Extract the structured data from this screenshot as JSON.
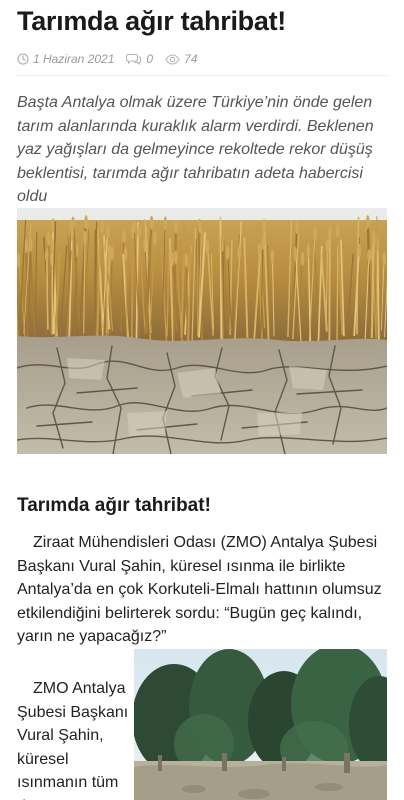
{
  "article": {
    "title": "Tarımda ağır tahribat!",
    "meta": {
      "date": "1 Haziran 2021",
      "comments": "0",
      "views": "74"
    },
    "lead": "Başta Antalya olmak üzere Türkiye’nin önde gelen tarım alanlarında kuraklık alarm verdirdi. Beklenen yaz yağışları da gelmeyince rekoltede rekor düşüş beklentisi, tarımda ağır tahribatın adeta habercisi oldu",
    "subheading": "Tarımda ağır tahribat!",
    "paragraph1": "Ziraat Mühendisleri Odası (ZMO) Antalya Şubesi Başkanı Vural Şahin, küresel ısınma ile birlikte Antalya’da en çok Korkuteli-Elmalı hattının olumsuz etkilendiğini belirterek sordu: “Bugün geç kalındı, yarın ne yapacağız?”",
    "paragraph2": "ZMO Antalya Şubesi Başkanı Vural Şahin, küresel ısınmanın tüm dünyayı"
  },
  "icons": {
    "date": "clock-icon",
    "comments": "comment-icon",
    "views": "eye-icon"
  },
  "colors": {
    "meta_text": "#9a9a9a",
    "lead_text": "#555555",
    "body_text": "#222222"
  }
}
